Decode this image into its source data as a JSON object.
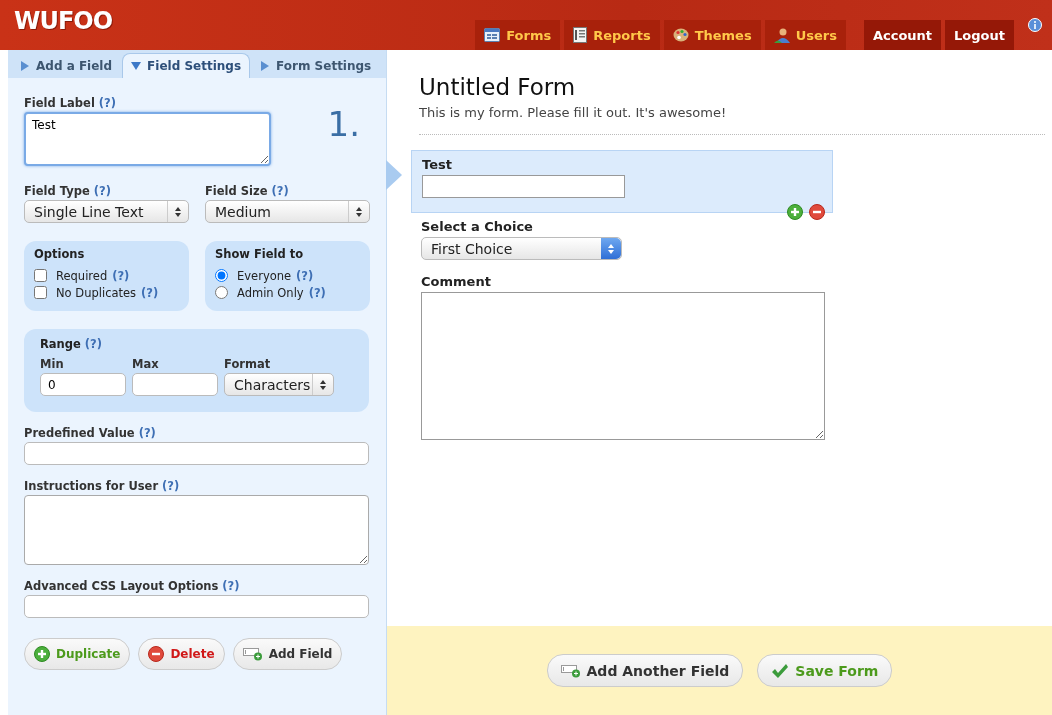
{
  "header": {
    "logo": "WUFOO",
    "nav": [
      {
        "label": "Forms",
        "kind": "main"
      },
      {
        "label": "Reports",
        "kind": "main"
      },
      {
        "label": "Themes",
        "kind": "main"
      },
      {
        "label": "Users",
        "kind": "main"
      },
      {
        "label": "Account",
        "kind": "account"
      },
      {
        "label": "Logout",
        "kind": "account"
      }
    ]
  },
  "sidebar": {
    "tabs": [
      {
        "label": "Add a Field",
        "selected": false
      },
      {
        "label": "Field Settings",
        "selected": true
      },
      {
        "label": "Form Settings",
        "selected": false
      }
    ],
    "field_number": "1.",
    "field_label": {
      "label": "Field Label",
      "help": "(?)",
      "value": "Test"
    },
    "field_type": {
      "label": "Field Type",
      "help": "(?)",
      "value": "Single Line Text"
    },
    "field_size": {
      "label": "Field Size",
      "help": "(?)",
      "value": "Medium"
    },
    "options": {
      "title": "Options",
      "items": [
        {
          "label": "Required",
          "help": "(?)",
          "checked": false
        },
        {
          "label": "No Duplicates",
          "help": "(?)",
          "checked": false
        }
      ]
    },
    "show_field_to": {
      "title": "Show Field to",
      "items": [
        {
          "label": "Everyone",
          "help": "(?)",
          "selected": true
        },
        {
          "label": "Admin Only",
          "help": "(?)",
          "selected": false
        }
      ]
    },
    "range": {
      "title": "Range",
      "help": "(?)",
      "min": {
        "label": "Min",
        "value": "0"
      },
      "max": {
        "label": "Max"
      },
      "format": {
        "label": "Format",
        "value": "Characters"
      }
    },
    "predefined_value": {
      "label": "Predefined Value",
      "help": "(?)"
    },
    "instructions": {
      "label": "Instructions for User",
      "help": "(?)"
    },
    "advanced_css": {
      "label": "Advanced CSS Layout Options",
      "help": "(?)"
    },
    "buttons": [
      {
        "label": "Duplicate",
        "kind": "duplicate"
      },
      {
        "label": "Delete",
        "kind": "delete"
      },
      {
        "label": "Add Field",
        "kind": "add"
      }
    ]
  },
  "form": {
    "title": "Untitled Form",
    "description": "This is my form. Please fill it out. It's awesome!",
    "fields": [
      {
        "kind": "text",
        "label": "Test",
        "selected": true
      },
      {
        "kind": "select",
        "label": "Select a Choice",
        "value": "First Choice"
      },
      {
        "kind": "textarea",
        "label": "Comment"
      }
    ]
  },
  "footer": {
    "buttons": [
      {
        "label": "Add Another Field",
        "kind": "add"
      },
      {
        "label": "Save Form",
        "kind": "save"
      }
    ]
  }
}
